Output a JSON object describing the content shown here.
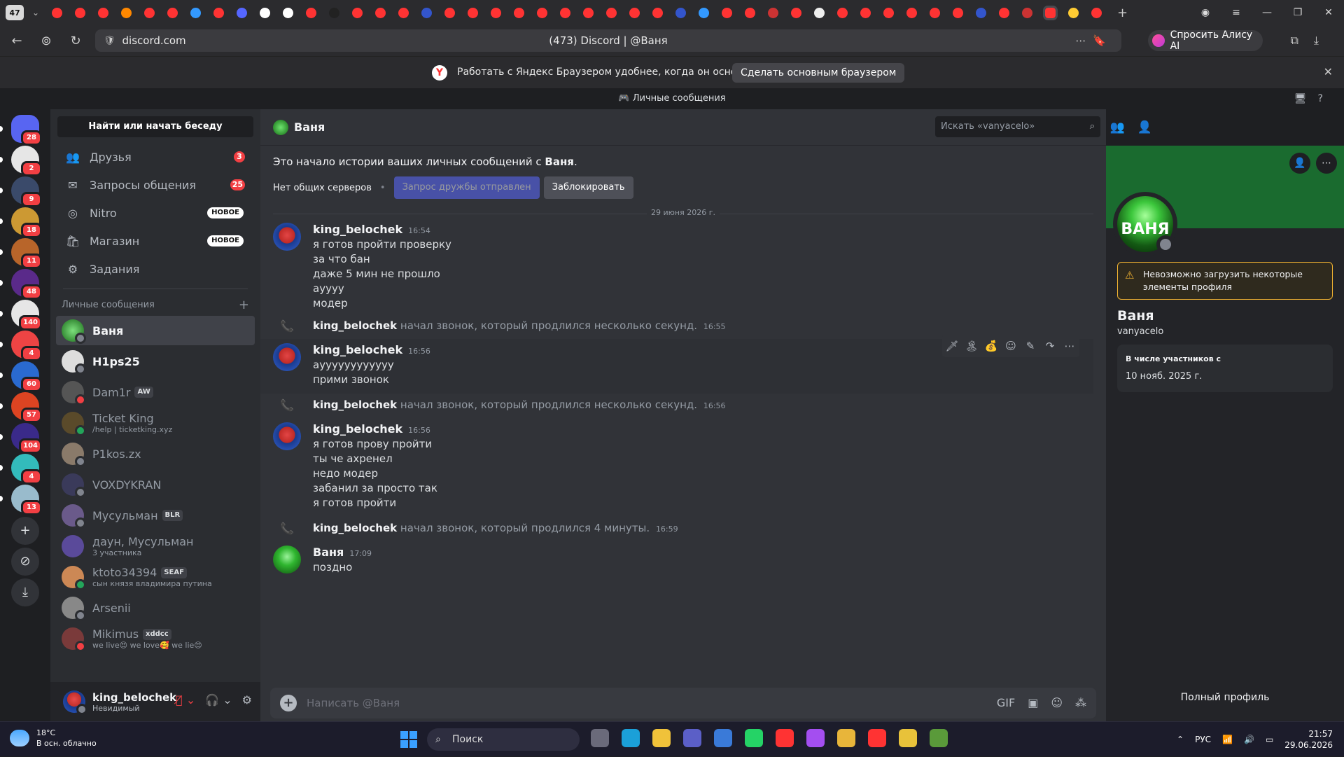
{
  "browser": {
    "tab_count": "47",
    "url": "discord.com",
    "page_title": "(473) Discord | @Ваня",
    "alice_label": "Спросить Алису AI"
  },
  "infobar": {
    "text": "Работать с Яндекс Браузером удобнее, когда он основной",
    "button": "Сделать основным браузером"
  },
  "discord_title": "Личные сообщения",
  "guild_badges": [
    "28",
    "2",
    "9",
    "18",
    "11",
    "48",
    "140",
    "4",
    "60",
    "57",
    "104",
    "4",
    "13"
  ],
  "sidebar": {
    "find_label": "Найти или начать беседу",
    "nav": [
      {
        "label": "Друзья",
        "badge": "3",
        "icon": "friends-icon"
      },
      {
        "label": "Запросы общения",
        "badge": "25",
        "icon": "mail-icon"
      },
      {
        "label": "Nitro",
        "tag": "НОВОЕ",
        "icon": "nitro-icon"
      },
      {
        "label": "Магазин",
        "tag": "НОВОЕ",
        "icon": "shop-icon"
      },
      {
        "label": "Задания",
        "icon": "quests-icon"
      }
    ],
    "dm_header": "Личные сообщения",
    "dms": [
      {
        "name": "Ваня",
        "active": true
      },
      {
        "name": "H1ps25",
        "bold": true
      },
      {
        "name": "Dam1r",
        "tag": "AW"
      },
      {
        "name": "Ticket King",
        "sub": "/help | ticketking.xyz"
      },
      {
        "name": "P1kos.zx"
      },
      {
        "name": "VOXDYKRAN"
      },
      {
        "name": "Мусульман",
        "tag": "BLR"
      },
      {
        "name": "даун, Мусульман",
        "sub": "3 участника"
      },
      {
        "name": "ktoto34394",
        "tag": "SEAF",
        "sub": "сын князя владимира путина"
      },
      {
        "name": "Arsenii"
      },
      {
        "name": "Mikimus",
        "tag": "xddcc",
        "sub": "we live😍 we love🥰 we lie😍"
      }
    ]
  },
  "user": {
    "name": "king_belochek",
    "status": "Невидимый"
  },
  "chat": {
    "header_name": "Ваня",
    "search_placeholder": "Искать «vanyacelo»",
    "intro_prefix": "Это начало истории ваших личных сообщений с ",
    "intro_name": "Ваня",
    "no_servers": "Нет общих серверов",
    "friend_sent": "Запрос дружбы отправлен",
    "block": "Заблокировать",
    "date": "29 июня 2026 г.",
    "messages": [
      {
        "author": "king_belochek",
        "time": "16:54",
        "lines": [
          "я готов пройти проверку",
          "за что бан",
          "даже 5 мин не прошло",
          "ауууу",
          "модер"
        ]
      },
      {
        "call": true,
        "author": "king_belochek",
        "text": "начал звонок, который продлился несколько секунд.",
        "time": "16:55"
      },
      {
        "author": "king_belochek",
        "time": "16:56",
        "lines": [
          "ауууууууууууу",
          "прими звонок"
        ]
      },
      {
        "call": true,
        "author": "king_belochek",
        "text": "начал звонок, который продлился несколько секунд.",
        "time": "16:56"
      },
      {
        "author": "king_belochek",
        "time": "16:56",
        "lines": [
          "я готов прову пройти",
          "ты че ахренел",
          "недо модер",
          "забанил за просто так",
          "я готов пройти"
        ]
      },
      {
        "call": true,
        "author": "king_belochek",
        "text": "начал звонок, который продлился 4 минуты.",
        "time": "16:59"
      },
      {
        "author": "Ваня",
        "time": "17:09",
        "lines": [
          "поздно"
        ]
      }
    ],
    "composer_placeholder": "Написать @Ваня"
  },
  "profile": {
    "avatar_text": "ВАНЯ",
    "warning": "Невозможно загрузить некоторые элементы профиля",
    "name": "Ваня",
    "username": "vanyacelo",
    "member_since_label": "В числе участников с",
    "member_since": "10 нояб. 2025 г.",
    "full_profile": "Полный профиль"
  },
  "taskbar": {
    "temp": "18°C",
    "weather": "В осн. облачно",
    "search": "Поиск",
    "lang": "РУС",
    "time": "21:57",
    "date": "29.06.2026"
  }
}
